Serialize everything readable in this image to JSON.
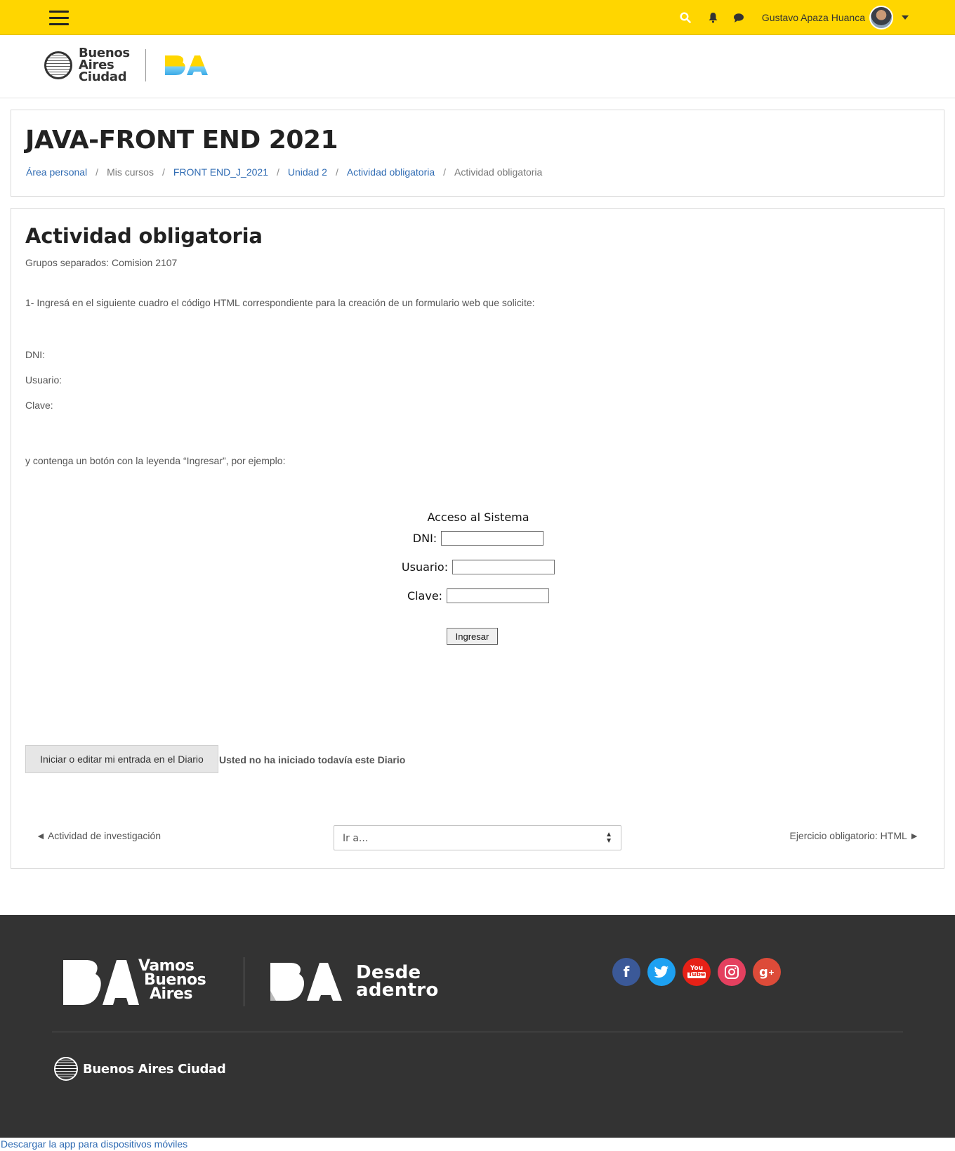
{
  "topbar": {
    "user_name": "Gustavo Apaza Huanca",
    "icons": [
      "menu-icon",
      "search-icon",
      "bell-icon",
      "chat-icon",
      "chevron-down-icon"
    ],
    "accent_color": "#ffd600"
  },
  "brand": {
    "city_lines": [
      "Buenos",
      "Aires",
      "Ciudad"
    ],
    "ba_logo": "BA"
  },
  "course": {
    "title": "JAVA-FRONT END 2021",
    "breadcrumb": [
      {
        "label": "Área personal",
        "link": true
      },
      {
        "label": "Mis cursos",
        "link": false
      },
      {
        "label": "FRONT END_J_2021",
        "link": true
      },
      {
        "label": "Unidad 2",
        "link": true
      },
      {
        "label": "Actividad obligatoria",
        "link": true
      },
      {
        "label": "Actividad obligatoria",
        "link": false
      }
    ]
  },
  "activity": {
    "heading": "Actividad obligatoria",
    "groups": "Grupos separados: Comision 2107",
    "intro": "1- Ingresá en el siguiente cuadro el código HTML correspondiente para la creación de un formulario web que solicite:",
    "fields": [
      "DNI:",
      "Usuario:",
      "Clave:"
    ],
    "contenga": "y contenga un botón con la leyenda “Ingresar”, por ejemplo:",
    "example": {
      "title": "Acceso al Sistema",
      "dni_label": "DNI:",
      "usuario_label": "Usuario:",
      "clave_label": "Clave:",
      "button": "Ingresar"
    },
    "diary_button": "Iniciar o editar mi entrada en el Diario",
    "diary_status": "Usted no ha iniciado todavía este Diario"
  },
  "nav": {
    "prev": "◄ Actividad de investigación",
    "jump_placeholder": "Ir a...",
    "next": "Ejercicio obligatorio: HTML ►"
  },
  "footer": {
    "vamos": [
      "Vamos",
      "Buenos",
      "Aires"
    ],
    "desde": [
      "Desde",
      "adentro"
    ],
    "social": [
      {
        "name": "facebook-icon",
        "glyph": "f",
        "color": "#3b5998"
      },
      {
        "name": "twitter-icon",
        "glyph": "🐦",
        "color": "#1da1f2"
      },
      {
        "name": "youtube-icon",
        "glyph": "You",
        "color": "#e62117"
      },
      {
        "name": "instagram-icon",
        "glyph": "◎",
        "color": "#e4405f"
      },
      {
        "name": "google-plus-icon",
        "glyph": "g+",
        "color": "#dd4b39"
      }
    ],
    "city_name": "Buenos Aires Ciudad",
    "app_link": "Descargar la app para dispositivos móviles"
  }
}
